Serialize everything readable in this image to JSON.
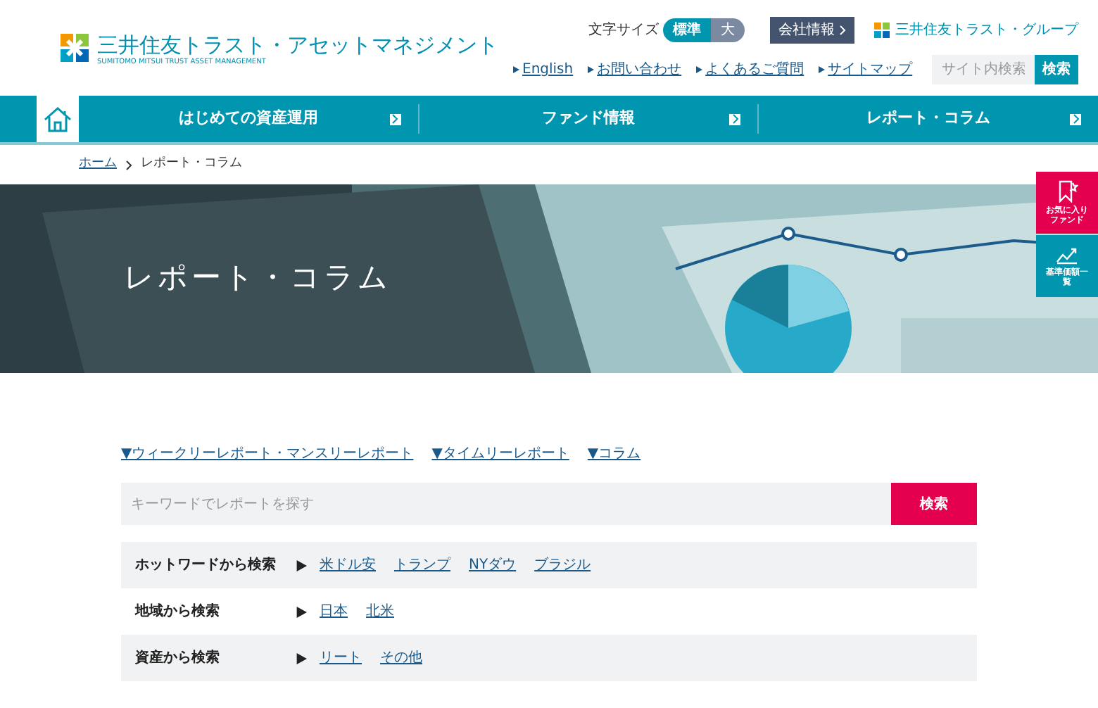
{
  "header": {
    "logo": {
      "name": "三井住友トラスト・アセットマネジメント",
      "subtitle": "SUMITOMO MITSUI TRUST ASSET MANAGEMENT"
    },
    "font_size": {
      "label": "文字サイズ",
      "options": [
        {
          "label": "標準",
          "selected": true
        },
        {
          "label": "大",
          "selected": false
        }
      ]
    },
    "company_link": "会社情報",
    "group_logo": "三井住友トラスト・グループ",
    "links": [
      "English",
      "お問い合わせ",
      "よくあるご質問",
      "サイトマップ"
    ],
    "search": {
      "placeholder": "サイト内検索",
      "button": "検索"
    }
  },
  "nav": {
    "items": [
      {
        "label": "はじめての資産運用"
      },
      {
        "label": "ファンド情報"
      },
      {
        "label": "レポート・コラム"
      }
    ]
  },
  "breadcrumb": [
    {
      "label": "ホーム",
      "link": true
    },
    {
      "label": "レポート・コラム",
      "link": false
    }
  ],
  "hero": {
    "title": "レポート・コラム"
  },
  "side_buttons": [
    {
      "label": "お気に入りファンド",
      "kind": "favorite"
    },
    {
      "label": "基準価額一覧",
      "kind": "chart"
    }
  ],
  "anchors": [
    "▼ウィークリーレポート・マンスリーレポート",
    "▼タイムリーレポート",
    "▼コラム"
  ],
  "keyword_search": {
    "placeholder": "キーワードでレポートを探す",
    "button": "検索"
  },
  "filters": [
    {
      "label": "ホットワードから検索",
      "tags": [
        "米ドル安",
        "トランプ",
        "NYダウ",
        "ブラジル"
      ]
    },
    {
      "label": "地域から検索",
      "tags": [
        "日本",
        "北米"
      ]
    },
    {
      "label": "資産から検索",
      "tags": [
        "リート",
        "その他"
      ]
    }
  ]
}
